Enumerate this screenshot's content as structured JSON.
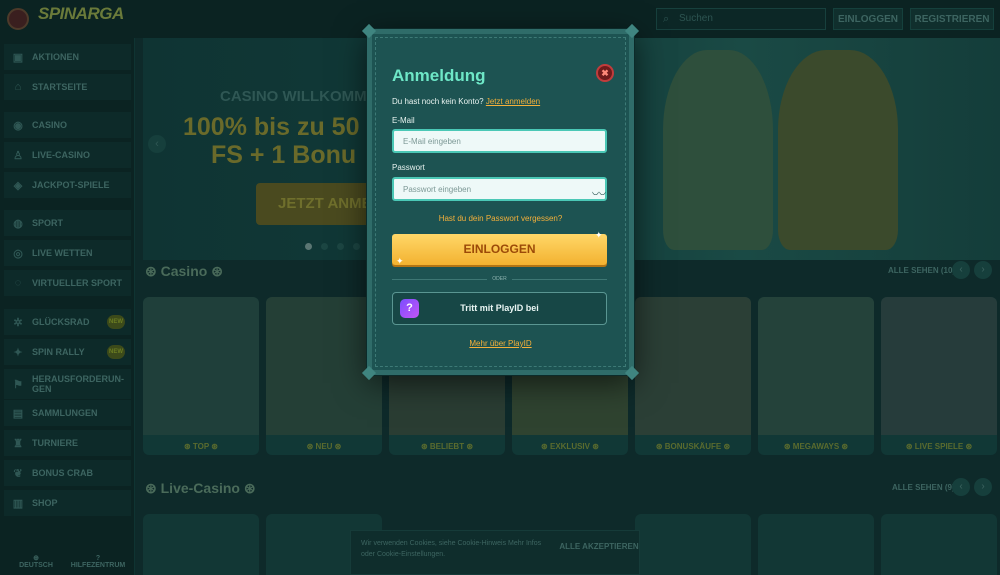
{
  "header": {
    "search_placeholder": "Suchen",
    "login_label": "EINLOGGEN",
    "register_label": "REGISTRIEREN"
  },
  "sidebar": {
    "items": [
      {
        "label": "AKTIONEN",
        "icon": "gift-icon"
      },
      {
        "label": "STARTSEITE",
        "icon": "home-icon"
      },
      {
        "label": "CASINO",
        "icon": "casino-chip-icon"
      },
      {
        "label": "LIVE-CASINO",
        "icon": "bell-icon"
      },
      {
        "label": "JACKPOT-SPIELE",
        "icon": "jackpot-icon"
      },
      {
        "label": "SPORT",
        "icon": "ball-icon"
      },
      {
        "label": "LIVE WETTEN",
        "icon": "live-icon"
      },
      {
        "label": "VIRTUELLER SPORT",
        "icon": "virtual-icon"
      },
      {
        "label": "GLÜCKSRAD",
        "icon": "wheel-icon",
        "badge": "NEW"
      },
      {
        "label": "SPIN RALLY",
        "icon": "rally-icon",
        "badge": "NEW"
      },
      {
        "label": "HERAUSFORDERUN-GEN",
        "icon": "challenge-icon"
      },
      {
        "label": "SAMMLUNGEN",
        "icon": "collection-icon"
      },
      {
        "label": "TURNIERE",
        "icon": "trophy-icon"
      },
      {
        "label": "BONUS CRAB",
        "icon": "crab-icon"
      },
      {
        "label": "SHOP",
        "icon": "shop-icon"
      }
    ],
    "bottom": [
      {
        "label": "DEUTSCH",
        "icon": "globe-icon"
      },
      {
        "label": "HILFEZENTRUM",
        "icon": "help-icon"
      }
    ]
  },
  "hero": {
    "title": "CASINO WILLKOMME",
    "line1": "100% bis zu 50",
    "line2": "FS + 1 Bonu",
    "button": "JETZT ANMEL"
  },
  "sections": {
    "casino": {
      "title": "Casino",
      "see_all": "ALLE SEHEN (10)",
      "cards": [
        "TOP",
        "NEU",
        "BELIEBT",
        "EXKLUSIV",
        "BONUSKÄUFE",
        "MEGAWAYS",
        "LIVE SPIELE"
      ]
    },
    "live_casino": {
      "title": "Live-Casino",
      "see_all": "ALLE SEHEN (9)"
    }
  },
  "cookie": {
    "text": "Wir verwenden Cookies, siehe Cookie-Hinweis Mehr Infos oder Cookie-Einstellungen.",
    "accept": "ALLE AKZEPTIEREN"
  },
  "modal": {
    "title": "Anmeldung",
    "no_account": "Du hast noch kein Konto?",
    "register_link": "Jetzt anmelden",
    "email_label": "E-Mail",
    "email_placeholder": "E-Mail eingeben",
    "password_label": "Passwort",
    "password_placeholder": "Passwort eingeben",
    "forgot": "Hast du dein Passwort vergessen?",
    "login_button": "EINLOGGEN",
    "or": "ODER",
    "playid_button": "Tritt mit PlayID bei",
    "more_playid": "Mehr über PlayID"
  },
  "colors": {
    "accent": "#6ee7c7",
    "button": "#f3b230",
    "link": "#f5b03a",
    "modal_bg": "#1d5352",
    "page_bg": "#0e2a2a"
  }
}
